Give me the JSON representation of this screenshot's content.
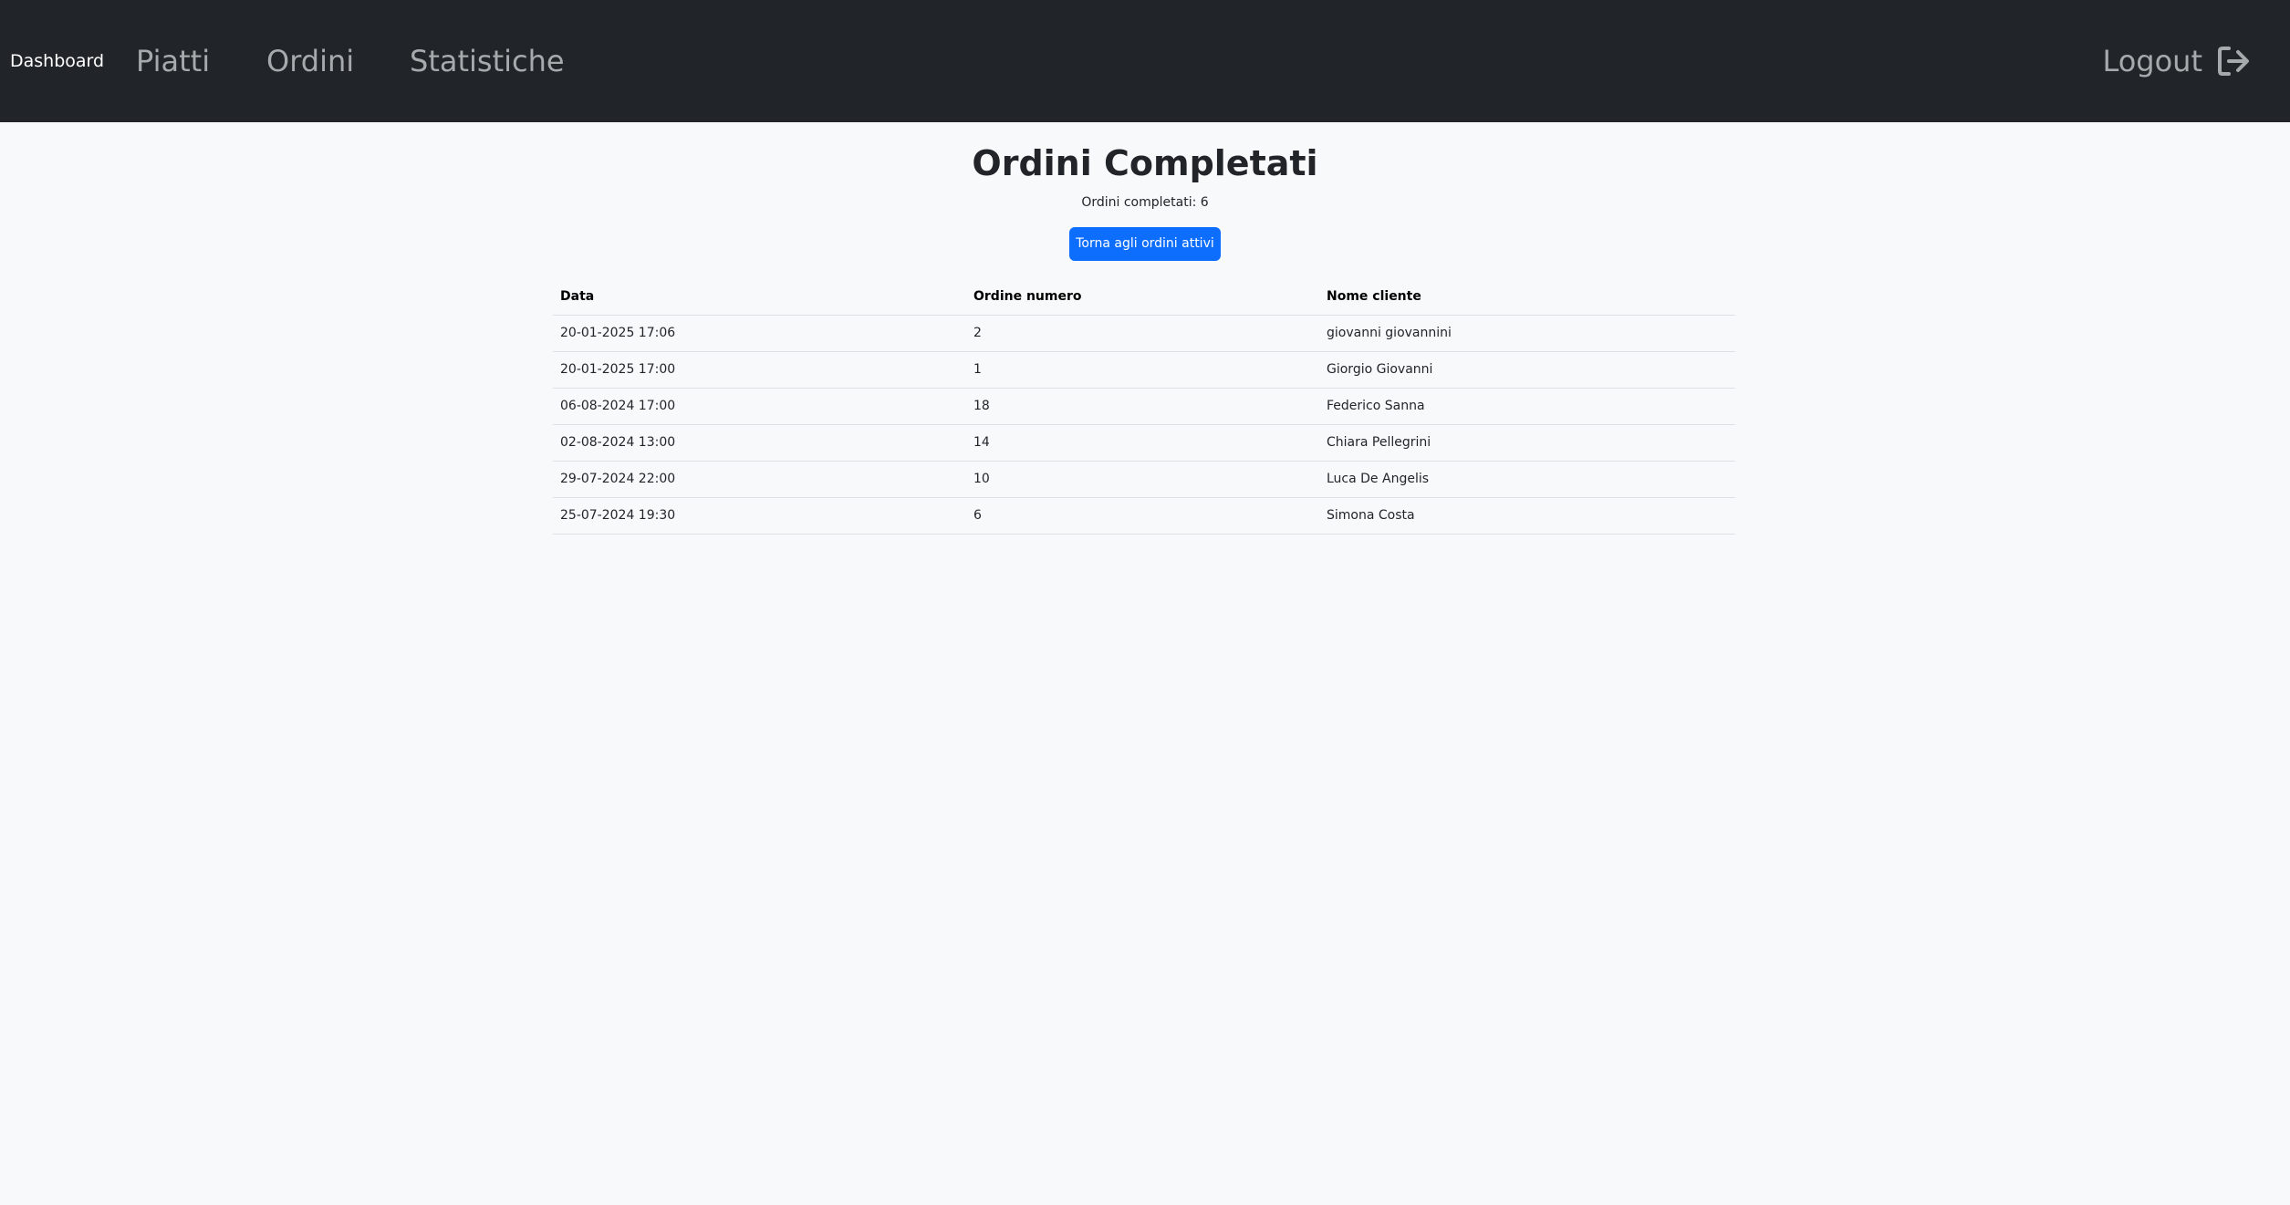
{
  "navbar": {
    "brand": "Dashboard",
    "links": {
      "piatti": "Piatti",
      "ordini": "Ordini",
      "statistiche": "Statistiche"
    },
    "logout_label": "Logout",
    "logout_icon": "logout-icon",
    "background_color": "#212529"
  },
  "main": {
    "title": "Ordini Completati",
    "count_text": "Ordini completati: 6",
    "back_button_label": "Torna agli ordini attivi",
    "back_button_color": "#0d6efd"
  },
  "table": {
    "headers": [
      "Data",
      "Ordine numero",
      "Nome cliente"
    ],
    "rows": [
      [
        "20-01-2025 17:06",
        "2",
        "giovanni giovannini"
      ],
      [
        "20-01-2025 17:00",
        "1",
        "Giorgio Giovanni"
      ],
      [
        "06-08-2024 17:00",
        "18",
        "Federico Sanna"
      ],
      [
        "02-08-2024 13:00",
        "14",
        "Chiara Pellegrini"
      ],
      [
        "29-07-2024 22:00",
        "10",
        "Luca De Angelis"
      ],
      [
        "25-07-2024 19:30",
        "6",
        "Simona Costa"
      ]
    ]
  }
}
